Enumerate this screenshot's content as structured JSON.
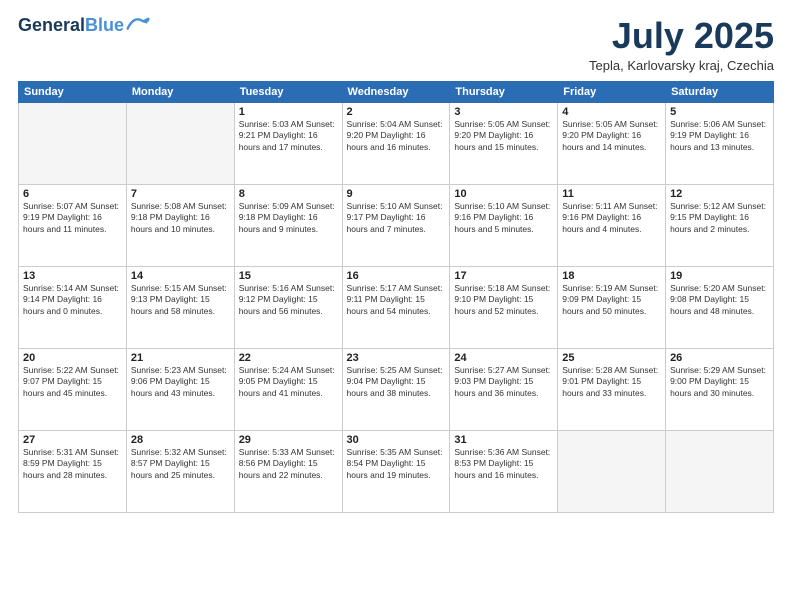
{
  "logo": {
    "line1": "General",
    "line2": "Blue"
  },
  "title": "July 2025",
  "subtitle": "Tepla, Karlovarsky kraj, Czechia",
  "days_of_week": [
    "Sunday",
    "Monday",
    "Tuesday",
    "Wednesday",
    "Thursday",
    "Friday",
    "Saturday"
  ],
  "weeks": [
    [
      {
        "day": "",
        "info": ""
      },
      {
        "day": "",
        "info": ""
      },
      {
        "day": "1",
        "info": "Sunrise: 5:03 AM\nSunset: 9:21 PM\nDaylight: 16 hours\nand 17 minutes."
      },
      {
        "day": "2",
        "info": "Sunrise: 5:04 AM\nSunset: 9:20 PM\nDaylight: 16 hours\nand 16 minutes."
      },
      {
        "day": "3",
        "info": "Sunrise: 5:05 AM\nSunset: 9:20 PM\nDaylight: 16 hours\nand 15 minutes."
      },
      {
        "day": "4",
        "info": "Sunrise: 5:05 AM\nSunset: 9:20 PM\nDaylight: 16 hours\nand 14 minutes."
      },
      {
        "day": "5",
        "info": "Sunrise: 5:06 AM\nSunset: 9:19 PM\nDaylight: 16 hours\nand 13 minutes."
      }
    ],
    [
      {
        "day": "6",
        "info": "Sunrise: 5:07 AM\nSunset: 9:19 PM\nDaylight: 16 hours\nand 11 minutes."
      },
      {
        "day": "7",
        "info": "Sunrise: 5:08 AM\nSunset: 9:18 PM\nDaylight: 16 hours\nand 10 minutes."
      },
      {
        "day": "8",
        "info": "Sunrise: 5:09 AM\nSunset: 9:18 PM\nDaylight: 16 hours\nand 9 minutes."
      },
      {
        "day": "9",
        "info": "Sunrise: 5:10 AM\nSunset: 9:17 PM\nDaylight: 16 hours\nand 7 minutes."
      },
      {
        "day": "10",
        "info": "Sunrise: 5:10 AM\nSunset: 9:16 PM\nDaylight: 16 hours\nand 5 minutes."
      },
      {
        "day": "11",
        "info": "Sunrise: 5:11 AM\nSunset: 9:16 PM\nDaylight: 16 hours\nand 4 minutes."
      },
      {
        "day": "12",
        "info": "Sunrise: 5:12 AM\nSunset: 9:15 PM\nDaylight: 16 hours\nand 2 minutes."
      }
    ],
    [
      {
        "day": "13",
        "info": "Sunrise: 5:14 AM\nSunset: 9:14 PM\nDaylight: 16 hours\nand 0 minutes."
      },
      {
        "day": "14",
        "info": "Sunrise: 5:15 AM\nSunset: 9:13 PM\nDaylight: 15 hours\nand 58 minutes."
      },
      {
        "day": "15",
        "info": "Sunrise: 5:16 AM\nSunset: 9:12 PM\nDaylight: 15 hours\nand 56 minutes."
      },
      {
        "day": "16",
        "info": "Sunrise: 5:17 AM\nSunset: 9:11 PM\nDaylight: 15 hours\nand 54 minutes."
      },
      {
        "day": "17",
        "info": "Sunrise: 5:18 AM\nSunset: 9:10 PM\nDaylight: 15 hours\nand 52 minutes."
      },
      {
        "day": "18",
        "info": "Sunrise: 5:19 AM\nSunset: 9:09 PM\nDaylight: 15 hours\nand 50 minutes."
      },
      {
        "day": "19",
        "info": "Sunrise: 5:20 AM\nSunset: 9:08 PM\nDaylight: 15 hours\nand 48 minutes."
      }
    ],
    [
      {
        "day": "20",
        "info": "Sunrise: 5:22 AM\nSunset: 9:07 PM\nDaylight: 15 hours\nand 45 minutes."
      },
      {
        "day": "21",
        "info": "Sunrise: 5:23 AM\nSunset: 9:06 PM\nDaylight: 15 hours\nand 43 minutes."
      },
      {
        "day": "22",
        "info": "Sunrise: 5:24 AM\nSunset: 9:05 PM\nDaylight: 15 hours\nand 41 minutes."
      },
      {
        "day": "23",
        "info": "Sunrise: 5:25 AM\nSunset: 9:04 PM\nDaylight: 15 hours\nand 38 minutes."
      },
      {
        "day": "24",
        "info": "Sunrise: 5:27 AM\nSunset: 9:03 PM\nDaylight: 15 hours\nand 36 minutes."
      },
      {
        "day": "25",
        "info": "Sunrise: 5:28 AM\nSunset: 9:01 PM\nDaylight: 15 hours\nand 33 minutes."
      },
      {
        "day": "26",
        "info": "Sunrise: 5:29 AM\nSunset: 9:00 PM\nDaylight: 15 hours\nand 30 minutes."
      }
    ],
    [
      {
        "day": "27",
        "info": "Sunrise: 5:31 AM\nSunset: 8:59 PM\nDaylight: 15 hours\nand 28 minutes."
      },
      {
        "day": "28",
        "info": "Sunrise: 5:32 AM\nSunset: 8:57 PM\nDaylight: 15 hours\nand 25 minutes."
      },
      {
        "day": "29",
        "info": "Sunrise: 5:33 AM\nSunset: 8:56 PM\nDaylight: 15 hours\nand 22 minutes."
      },
      {
        "day": "30",
        "info": "Sunrise: 5:35 AM\nSunset: 8:54 PM\nDaylight: 15 hours\nand 19 minutes."
      },
      {
        "day": "31",
        "info": "Sunrise: 5:36 AM\nSunset: 8:53 PM\nDaylight: 15 hours\nand 16 minutes."
      },
      {
        "day": "",
        "info": ""
      },
      {
        "day": "",
        "info": ""
      }
    ]
  ]
}
